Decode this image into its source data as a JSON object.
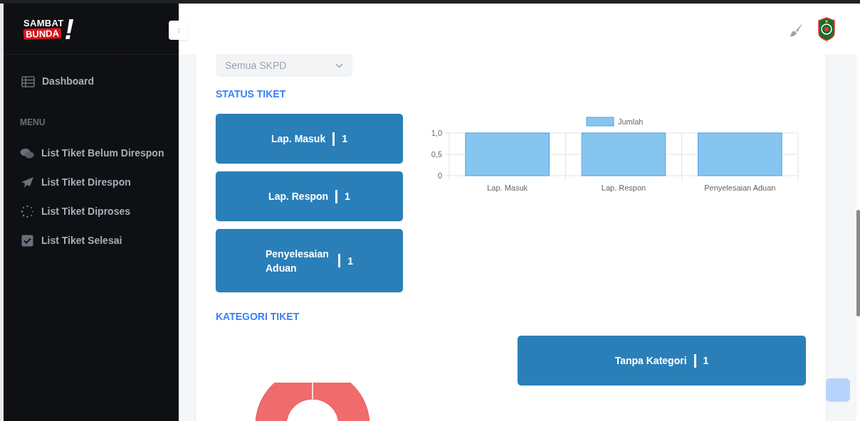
{
  "sidebar": {
    "logo": {
      "line_1": "SAMBAT",
      "line_2": "BUNDA",
      "mark": "!"
    },
    "dashboard": "Dashboard",
    "section_label": "MENU",
    "items": [
      {
        "label": "List Tiket Belum Direspon"
      },
      {
        "label": "List Tiket Direspon"
      },
      {
        "label": "List Tiket Diproses"
      },
      {
        "label": "List Tiket Selesai"
      }
    ]
  },
  "filter": {
    "value": "Semua SKPD"
  },
  "status": {
    "title": "STATUS TIKET",
    "cards": [
      {
        "label": "Lap. Masuk",
        "count": "1"
      },
      {
        "label": "Lap. Respon",
        "count": "1"
      },
      {
        "label": "Penyelesaian Aduan",
        "count": "1"
      }
    ],
    "chart_data": {
      "type": "bar",
      "categories": [
        "Lap. Masuk",
        "Lap. Respon",
        "Penyelesaian Aduan"
      ],
      "series": [
        {
          "name": "Jumlah",
          "color": "#87c5f1",
          "values": [
            1,
            1,
            1
          ]
        }
      ],
      "ylim": [
        0,
        1
      ],
      "yticks": [
        0,
        {
          "value": 0.5,
          "label": "0,5"
        },
        {
          "value": 1,
          "label": "1,0"
        }
      ]
    }
  },
  "category": {
    "title": "KATEGORI TIKET",
    "cards": [
      {
        "label": "Tanpa Kategori",
        "count": "1"
      }
    ]
  }
}
